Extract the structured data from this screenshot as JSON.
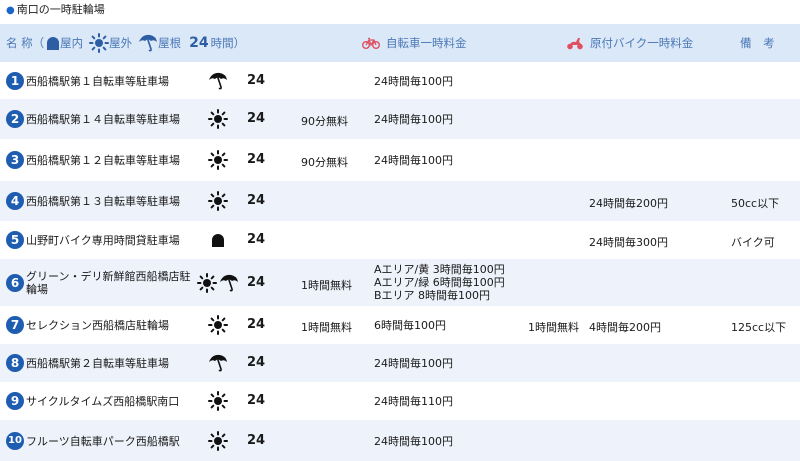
{
  "section_title": "南口の一時駐輪場",
  "header": {
    "name_label": "名 称（",
    "indoor_label": "屋内",
    "outdoor_label": "屋外",
    "roof_label": "屋根",
    "hours_bold": "24",
    "hours_suffix": "時間）",
    "bicycle_fee": "自転車一時料金",
    "moped_fee": "原付バイク一時料金",
    "remarks": "備 考",
    "bicycle_icon": "bicycle-icon",
    "moped_icon": "scooter-icon",
    "accent_color": "#4a78b6",
    "bike_icon_color": "#e05060"
  },
  "rows": [
    {
      "no": "1",
      "name": "西船橋駅第１自転車等駐車場",
      "icons": [
        "roof"
      ],
      "hours": "24",
      "bicycle_free": "",
      "bicycle_fee": "24時間毎100円",
      "moped_free": "",
      "moped_fee": "",
      "note": ""
    },
    {
      "no": "2",
      "name": "西船橋駅第１４自転車等駐車場",
      "icons": [
        "outdoor"
      ],
      "hours": "24",
      "bicycle_free": "90分無料",
      "bicycle_fee": "24時間毎100円",
      "moped_free": "",
      "moped_fee": "",
      "note": ""
    },
    {
      "no": "3",
      "name": "西船橋駅第１２自転車等駐車場",
      "icons": [
        "outdoor"
      ],
      "hours": "24",
      "bicycle_free": "90分無料",
      "bicycle_fee": "24時間毎100円",
      "moped_free": "",
      "moped_fee": "",
      "note": ""
    },
    {
      "no": "4",
      "name": "西船橋駅第１３自転車等駐車場",
      "icons": [
        "outdoor"
      ],
      "hours": "24",
      "bicycle_free": "",
      "bicycle_fee": "",
      "moped_free": "",
      "moped_fee": "24時間毎200円",
      "note": "50cc以下"
    },
    {
      "no": "5",
      "name": "山野町バイク専用時間貸駐車場",
      "icons": [
        "indoor"
      ],
      "hours": "24",
      "bicycle_free": "",
      "bicycle_fee": "",
      "moped_free": "",
      "moped_fee": "24時間毎300円",
      "note": "バイク可"
    },
    {
      "no": "6",
      "name": "グリーン・デリ新鮮館西船橋店駐輪場",
      "icons": [
        "outdoor",
        "roof"
      ],
      "hours": "24",
      "bicycle_free": "1時間無料",
      "bicycle_fee": "",
      "bicycle_fee_lines": [
        "Aエリア/黄 3時間毎100円",
        "Aエリア/緑 6時間毎100円",
        "Bエリア 8時間毎100円"
      ],
      "moped_free": "",
      "moped_fee": "",
      "note": ""
    },
    {
      "no": "7",
      "name": "セレクション西船橋店駐輪場",
      "icons": [
        "outdoor"
      ],
      "hours": "24",
      "bicycle_free": "1時間無料",
      "bicycle_fee": "6時間毎100円",
      "moped_free": "1時間無料",
      "moped_fee": "4時間毎200円",
      "note": "125cc以下"
    },
    {
      "no": "8",
      "name": "西船橋駅第２自転車等駐車場",
      "icons": [
        "roof"
      ],
      "hours": "24",
      "bicycle_free": "",
      "bicycle_fee": "24時間毎100円",
      "moped_free": "",
      "moped_fee": "",
      "note": ""
    },
    {
      "no": "9",
      "name": "サイクルタイムズ西船橋駅南口",
      "icons": [
        "outdoor"
      ],
      "hours": "24",
      "bicycle_free": "",
      "bicycle_fee": "24時間毎110円",
      "moped_free": "",
      "moped_fee": "",
      "note": ""
    },
    {
      "no": "10",
      "name": "フルーツ自転車パーク西船橋駅",
      "icons": [
        "outdoor"
      ],
      "hours": "24",
      "bicycle_free": "",
      "bicycle_fee": "24時間毎100円",
      "moped_free": "",
      "moped_fee": "",
      "note": ""
    }
  ]
}
